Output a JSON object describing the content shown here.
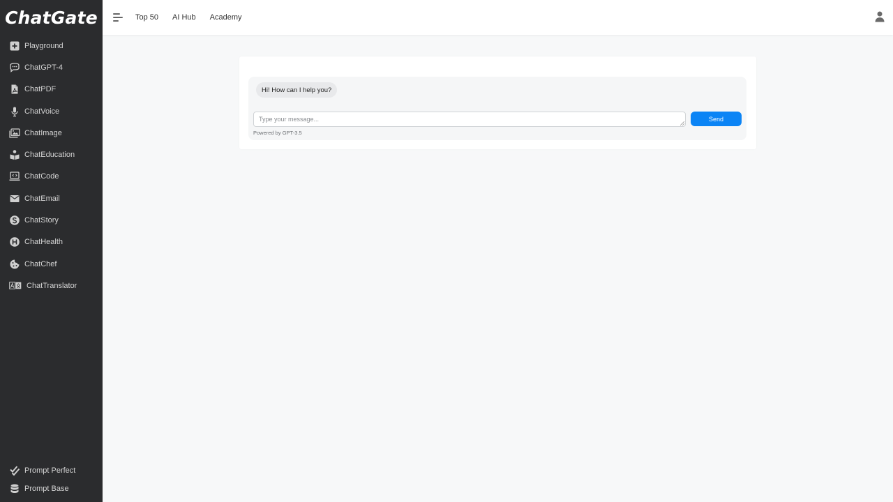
{
  "brand": {
    "name": "ChatGate"
  },
  "sidebar": {
    "items": [
      {
        "label": "Playground",
        "icon": "plus-square-icon"
      },
      {
        "label": "ChatGPT-4",
        "icon": "chat-bubble-icon"
      },
      {
        "label": "ChatPDF",
        "icon": "pdf-file-icon"
      },
      {
        "label": "ChatVoice",
        "icon": "microphone-icon"
      },
      {
        "label": "ChatImage",
        "icon": "image-gallery-icon"
      },
      {
        "label": "ChatEducation",
        "icon": "book-reader-icon"
      },
      {
        "label": "ChatCode",
        "icon": "laptop-code-icon"
      },
      {
        "label": "ChatEmail",
        "icon": "envelope-icon"
      },
      {
        "label": "ChatStory",
        "icon": "s-circle-icon"
      },
      {
        "label": "ChatHealth",
        "icon": "h-circle-icon"
      },
      {
        "label": "ChatChef",
        "icon": "cookie-icon"
      },
      {
        "label": "ChatTranslator",
        "icon": "translate-icon"
      }
    ],
    "bottom_items": [
      {
        "label": "Prompt Perfect",
        "icon": "double-check-icon"
      },
      {
        "label": "Prompt Base",
        "icon": "database-icon"
      }
    ]
  },
  "header": {
    "links": [
      "Top 50",
      "AI Hub",
      "Academy"
    ]
  },
  "chat": {
    "greeting": "Hi! How can I help you?",
    "input_placeholder": "Type your message...",
    "send_label": "Send",
    "powered_by": "Powered by GPT-3.5"
  },
  "colors": {
    "sidebar_bg": "#2b2c2e",
    "accent": "#0b84f5",
    "page_bg": "#f7f8f9"
  }
}
